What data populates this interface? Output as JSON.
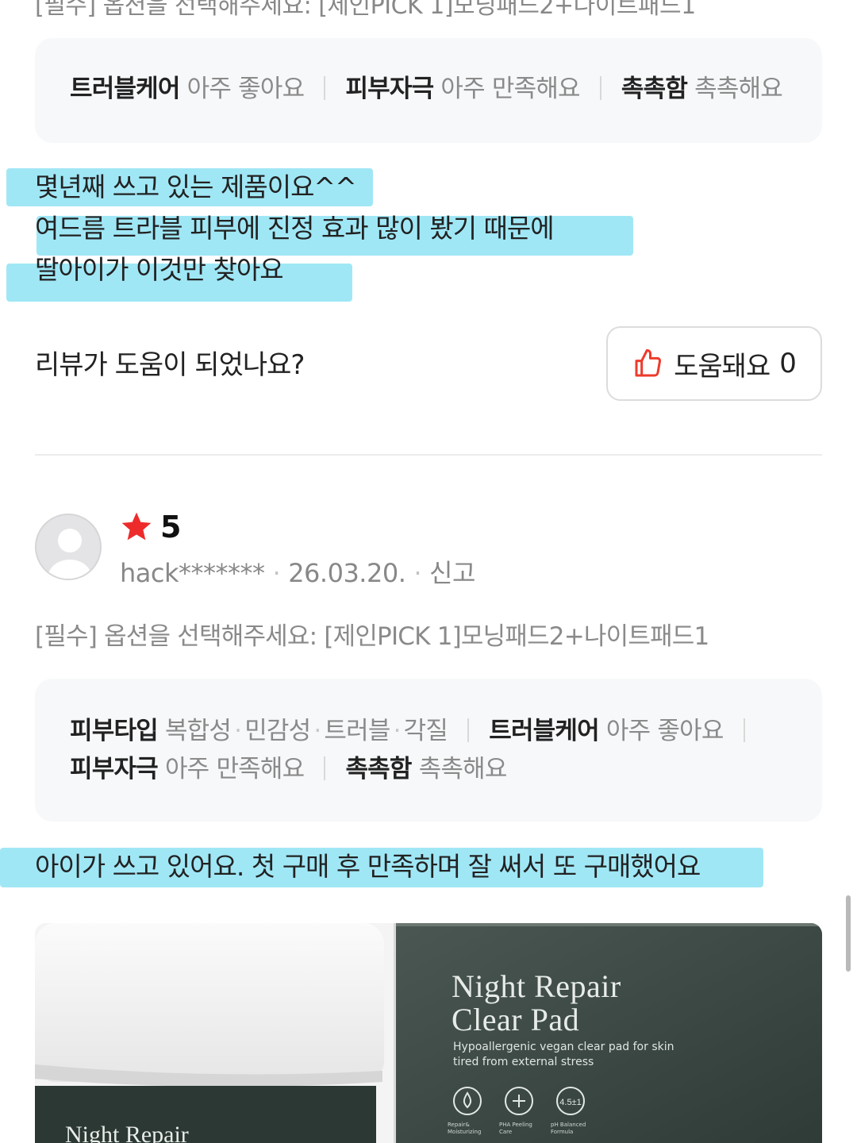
{
  "prev_review": {
    "attributes": [
      {
        "key": "트러블케어",
        "value": "아주 좋아요"
      },
      {
        "key": "피부자극",
        "value": "아주 만족해요"
      },
      {
        "key": "촉촉함",
        "value": "촉촉해요"
      }
    ],
    "body_lines": [
      "몇년째 쓰고 있는 제품이요^^",
      "여드름 트라블 피부에 진정 효과 많이 봤기 때문에",
      "딸아이가 이것만 찾아요"
    ],
    "helpful_question": "리뷰가 도움이 되었나요?",
    "helpful_label": "도움돼요",
    "helpful_count": "0"
  },
  "review": {
    "rating": "5",
    "user": "hack*******",
    "date": "26.03.20.",
    "report_label": "신고",
    "option_text": "[필수] 옵션을 선택해주세요: [제인PICK 1]모닝패드2+나이트패드1",
    "skin_type_key": "피부타입",
    "skin_types": [
      "복합성",
      "민감성",
      "트러블",
      "각질"
    ],
    "attributes": [
      {
        "key": "트러블케어",
        "value": "아주 좋아요"
      },
      {
        "key": "피부자극",
        "value": "아주 만족해요"
      },
      {
        "key": "촉촉함",
        "value": "촉촉해요"
      }
    ],
    "body_text": "아이가 쓰고 있어요. 첫 구매 후 만족하며 잘 써서 또 구매했어요",
    "photo": {
      "box_title_1": "Night Repair",
      "box_title_2": "Clear Pad",
      "box_sub_1": "Hypoallergenic vegan clear pad for skin",
      "box_sub_2": "tired from external stress",
      "icon_labels": [
        "Repair& Moisturizing",
        "PHA Peeling Care",
        "pH Balanced Formula"
      ],
      "jar_label": "Night Repair"
    }
  },
  "colors": {
    "highlight": "#8fe3f5",
    "star": "#ee2b2b",
    "thumb": "#ee3b2b",
    "box_bg": "#f7f8fa"
  }
}
